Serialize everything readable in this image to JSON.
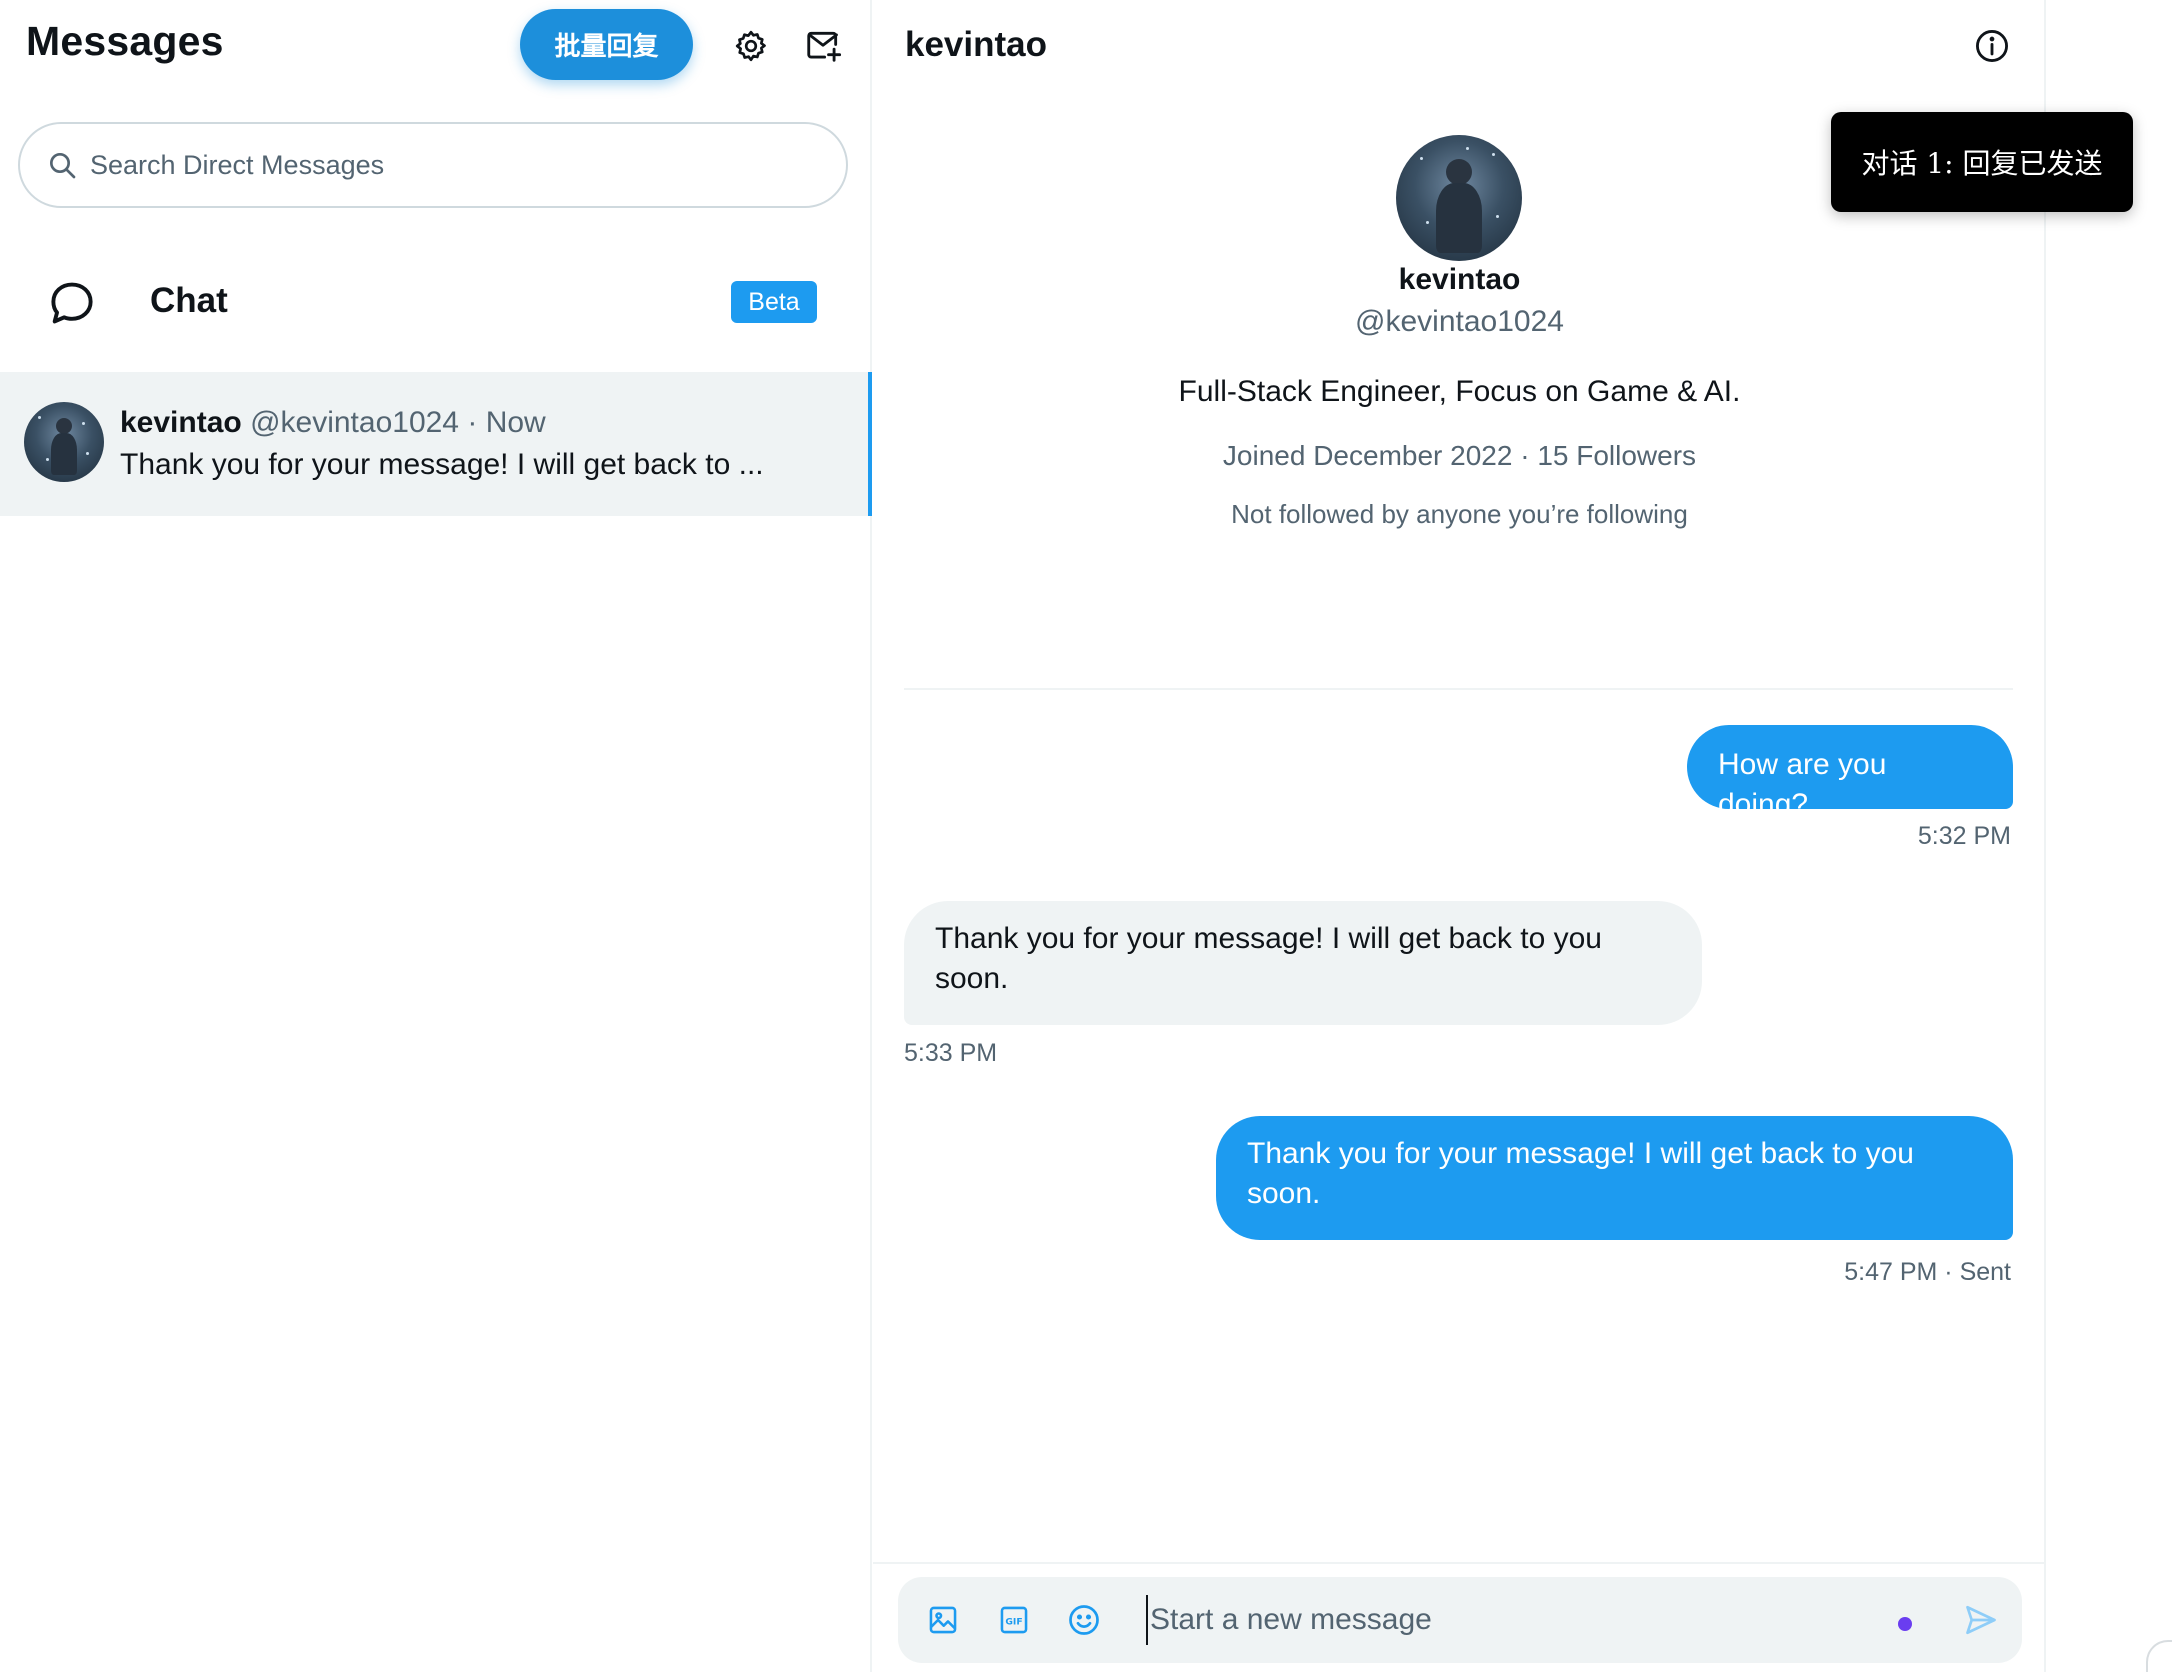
{
  "left_pane": {
    "title": "Messages",
    "batch_reply_label": "批量回复",
    "search": {
      "placeholder": "Search Direct Messages",
      "value": ""
    },
    "chat_row": {
      "label": "Chat",
      "badge": "Beta"
    },
    "conversations": [
      {
        "name": "kevintao",
        "handle": "@kevintao1024",
        "separator": "·",
        "time": "Now",
        "preview": "Thank you for your message! I will get back to ..."
      }
    ]
  },
  "right_pane": {
    "title": "kevintao",
    "profile": {
      "name": "kevintao",
      "handle": "@kevintao1024",
      "bio": "Full-Stack Engineer, Focus on Game & AI.",
      "joined": "Joined December 2022 · 15 Followers",
      "followed_note": "Not followed by anyone you’re following"
    },
    "messages": [
      {
        "direction": "outgoing",
        "text": "How are you doing?",
        "timestamp": "5:32 PM"
      },
      {
        "direction": "incoming",
        "text": "Thank you for your message! I will get back to you soon.",
        "timestamp": "5:33 PM"
      },
      {
        "direction": "outgoing",
        "text": "Thank you for your message! I will get back to you soon.",
        "timestamp": "5:47 PM · Sent"
      }
    ],
    "composer": {
      "placeholder": "Start a new message",
      "value": ""
    }
  },
  "toast": {
    "text": "对话 1: 回复已发送"
  },
  "icons": {
    "gear": "gear-icon",
    "new_message": "new-message-icon",
    "search": "search-icon",
    "chat": "chat-bubble-icon",
    "info": "info-icon",
    "image": "image-icon",
    "gif": "gif-icon",
    "emoji": "emoji-icon",
    "send": "send-icon"
  },
  "colors": {
    "accent": "#1d9bf0",
    "batch_button": "#1d8fdb",
    "selected_row": "#eff3f4",
    "muted_text": "#536471",
    "toast_bg": "#000000"
  }
}
